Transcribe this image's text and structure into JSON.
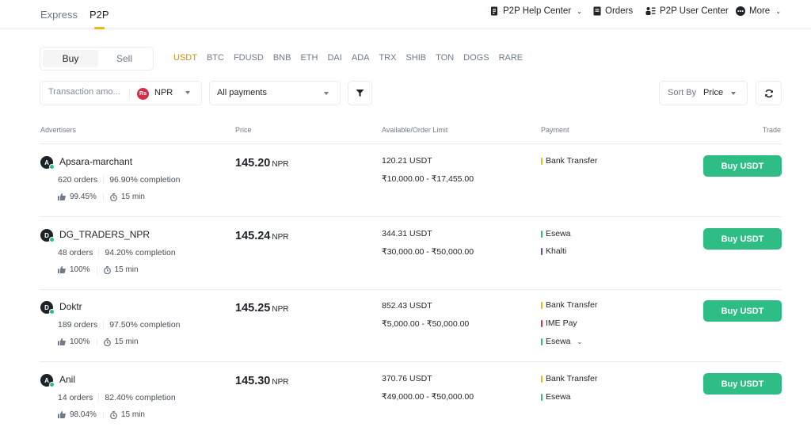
{
  "nav": {
    "tabs": [
      {
        "label": "Express"
      },
      {
        "label": "P2P"
      }
    ],
    "help_center": "P2P Help Center",
    "orders": "Orders",
    "user_center": "P2P User Center",
    "more": "More"
  },
  "trade_side": {
    "buy": "Buy",
    "sell": "Sell",
    "selected": "Buy"
  },
  "coins": [
    "USDT",
    "BTC",
    "FDUSD",
    "BNB",
    "ETH",
    "DAI",
    "ADA",
    "TRX",
    "SHIB",
    "TON",
    "DOGS",
    "RARE"
  ],
  "selected_coin": "USDT",
  "filters": {
    "amount_placeholder": "Transaction amo...",
    "currency_symbol": "Rs",
    "currency": "NPR",
    "payments": "All payments",
    "sort_label": "Sort By",
    "sort_value": "Price"
  },
  "table": {
    "headers": {
      "advertisers": "Advertisers",
      "price": "Price",
      "available": "Available/Order Limit",
      "payment": "Payment",
      "trade": "Trade"
    },
    "rows": [
      {
        "initial": "A",
        "name": "Apsara-marchant",
        "orders": "620 orders",
        "completion": "96.90% completion",
        "rating": "99.45%",
        "time": "15 min",
        "price": "145.20",
        "price_currency": "NPR",
        "available": "120.21 USDT",
        "limit": "₹10,000.00 - ₹17,455.00",
        "payments": [
          {
            "name": "Bank Transfer",
            "color": "#f0b90b"
          }
        ],
        "button": "Buy USDT"
      },
      {
        "initial": "D",
        "name": "DG_TRADERS_NPR",
        "orders": "48 orders",
        "completion": "94.20% completion",
        "rating": "100%",
        "time": "15 min",
        "price": "145.24",
        "price_currency": "NPR",
        "available": "344.31 USDT",
        "limit": "₹30,000.00 - ₹50,000.00",
        "payments": [
          {
            "name": "Esewa",
            "color": "#2ebd85"
          },
          {
            "name": "Khalti",
            "color": "#6f42c1"
          }
        ],
        "button": "Buy USDT"
      },
      {
        "initial": "D",
        "name": "Doktr",
        "orders": "189 orders",
        "completion": "97.50% completion",
        "rating": "100%",
        "time": "15 min",
        "price": "145.25",
        "price_currency": "NPR",
        "available": "852.43 USDT",
        "limit": "₹5,000.00 - ₹50,000.00",
        "payments": [
          {
            "name": "Bank Transfer",
            "color": "#f0b90b"
          },
          {
            "name": "IME Pay",
            "color": "#cf304a"
          },
          {
            "name": "Esewa",
            "color": "#2ebd85"
          }
        ],
        "button": "Buy USDT"
      },
      {
        "initial": "A",
        "name": "Anil",
        "orders": "14 orders",
        "completion": "82.40% completion",
        "rating": "98.04%",
        "time": "15 min",
        "price": "145.30",
        "price_currency": "NPR",
        "available": "370.76 USDT",
        "limit": "₹49,000.00 - ₹50,000.00",
        "payments": [
          {
            "name": "Bank Transfer",
            "color": "#f0b90b"
          },
          {
            "name": "Esewa",
            "color": "#2ebd85"
          }
        ],
        "button": "Buy USDT"
      }
    ]
  }
}
